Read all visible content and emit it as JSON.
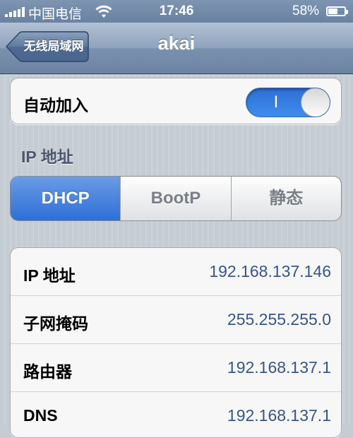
{
  "status_bar": {
    "carrier": "中国电信",
    "time": "17:46",
    "battery": "58%",
    "battery_level": 0.58
  },
  "nav": {
    "back_label": "无线局域网",
    "title": "akai"
  },
  "auto_join": {
    "label": "自动加入",
    "toggle_on_label": "I",
    "state": "on"
  },
  "ip_section": {
    "header": "IP 地址",
    "segments": [
      "DHCP",
      "BootP",
      "静态"
    ],
    "selected_segment": "DHCP"
  },
  "info_rows": [
    {
      "label": "IP 地址",
      "value": "192.168.137.146"
    },
    {
      "label": "子网掩码",
      "value": "255.255.255.0"
    },
    {
      "label": "路由器",
      "value": "192.168.137.1"
    },
    {
      "label": "DNS",
      "value": "192.168.137.1"
    }
  ],
  "colors": {
    "accent_blue": "#2e6fd6",
    "value_text": "#385487",
    "nav_bar": "#7a91ae"
  }
}
